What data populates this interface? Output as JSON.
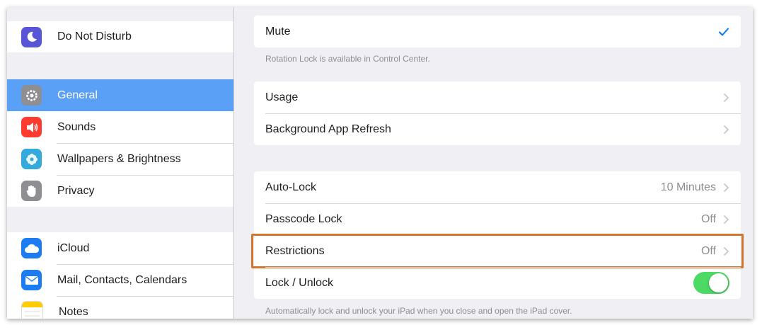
{
  "sidebar": {
    "items": [
      {
        "label": "Do Not Disturb",
        "icon": "moon-icon",
        "color": "#5856d6"
      },
      {
        "label": "General",
        "icon": "gear-icon",
        "color": "#8e8e93",
        "selected": true
      },
      {
        "label": "Sounds",
        "icon": "speaker-icon",
        "color": "#ff3b30"
      },
      {
        "label": "Wallpapers & Brightness",
        "icon": "flower-icon",
        "color": "#34aadc"
      },
      {
        "label": "Privacy",
        "icon": "hand-icon",
        "color": "#8e8e93"
      },
      {
        "label": "iCloud",
        "icon": "cloud-icon",
        "color": "#1d7cf2"
      },
      {
        "label": "Mail, Contacts, Calendars",
        "icon": "envelope-icon",
        "color": "#1d7cf2"
      },
      {
        "label": "Notes",
        "icon": "notes-icon",
        "color": "#ffcc00"
      }
    ],
    "selected_color": "#5aa0f7"
  },
  "main": {
    "mute": {
      "label": "Mute",
      "checked": true,
      "check_color": "#007aff"
    },
    "rotation_note": "Rotation Lock is available in Control Center.",
    "usage_group": {
      "usage": {
        "label": "Usage"
      },
      "background_refresh": {
        "label": "Background App Refresh"
      }
    },
    "lock_group": {
      "auto_lock": {
        "label": "Auto-Lock",
        "value": "10 Minutes"
      },
      "passcode_lock": {
        "label": "Passcode Lock",
        "value": "Off"
      },
      "restrictions": {
        "label": "Restrictions",
        "value": "Off",
        "highlight_color": "#d2752e"
      },
      "lock_unlock": {
        "label": "Lock / Unlock",
        "enabled": true,
        "toggle_color": "#4cd964"
      }
    },
    "lock_note": "Automatically lock and unlock your iPad when you close and open the iPad cover."
  }
}
